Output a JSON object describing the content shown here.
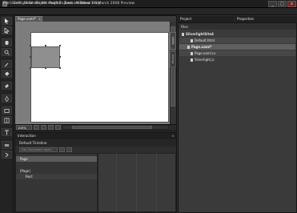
{
  "window": {
    "title": "Silverlight Site4 - Microsoft Expression Blend 2.5 March 2008 Preview",
    "minimize": "_",
    "maximize": "□",
    "close": "x"
  },
  "menu": [
    "File",
    "Edit",
    "View",
    "Object",
    "Project",
    "Tools",
    "Window",
    "Help"
  ],
  "document": {
    "tab_label": "Page.xaml*",
    "tab_close": "x",
    "side_tabs": [
      "XAML",
      "Design"
    ],
    "zoom": "100%"
  },
  "interaction": {
    "title": "Interaction",
    "close": "x",
    "timeline": "(No Storyboard open)",
    "trigger": "Default Timeline",
    "tree": [
      {
        "label": "Page",
        "depth": 0
      },
      {
        "label": "[Page]",
        "depth": 0
      },
      {
        "label": "Rect",
        "depth": 1
      }
    ]
  },
  "project": {
    "tab": "Project",
    "properties_tab": "Properties",
    "files_label": "Files",
    "items": [
      {
        "label": "SilverlightSite4",
        "bold": true
      },
      {
        "label": "Default.html"
      },
      {
        "label": "Page.xaml*",
        "bold": true
      },
      {
        "label": "Page.xaml.cs"
      },
      {
        "label": "Silverlight.js"
      }
    ]
  },
  "colors": {
    "chrome": "#2b2b2b",
    "artboard": "#ffffff",
    "selected_row": "#5f5f5f"
  }
}
